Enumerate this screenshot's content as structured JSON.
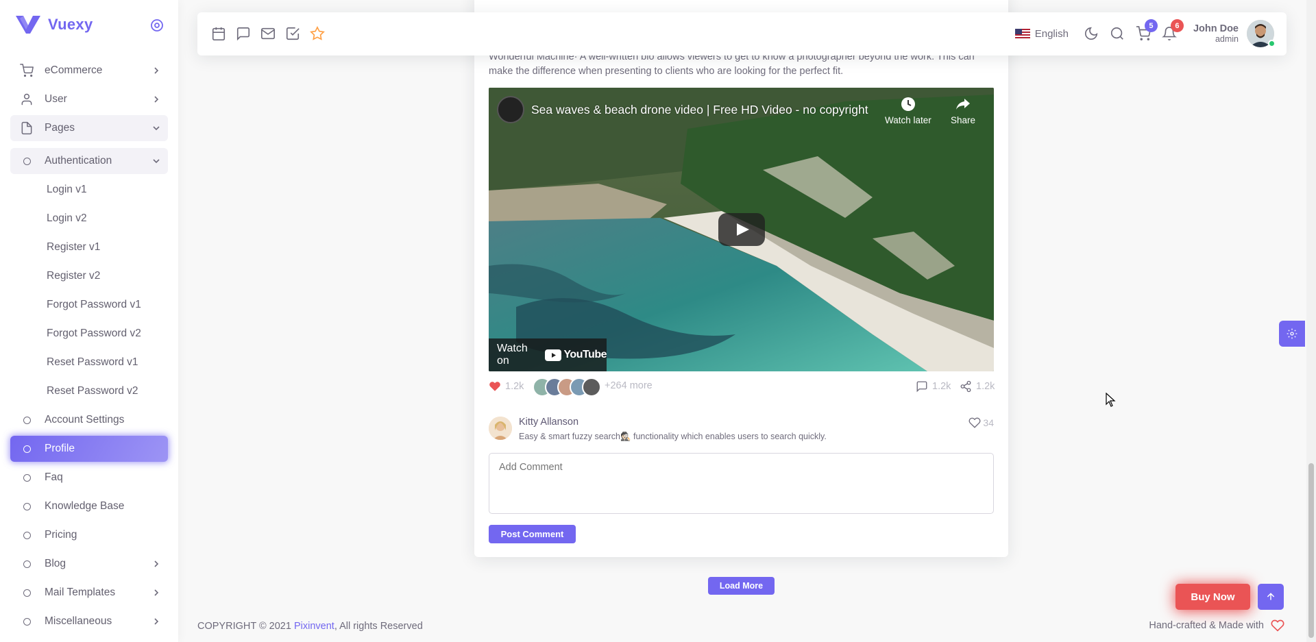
{
  "brand": {
    "name": "Vuexy",
    "color": "#7367f0"
  },
  "sidebar": {
    "items": [
      {
        "label": "eCommerce",
        "icon": "shopping-cart-icon",
        "chevron": "right"
      },
      {
        "label": "User",
        "icon": "user-icon",
        "chevron": "right"
      },
      {
        "label": "Pages",
        "icon": "file-icon",
        "chevron": "down",
        "state": "open"
      },
      {
        "label": "Authentication",
        "icon": "circle-icon",
        "chevron": "down",
        "state": "open"
      },
      {
        "label": "Login v1"
      },
      {
        "label": "Login v2"
      },
      {
        "label": "Register v1"
      },
      {
        "label": "Register v2"
      },
      {
        "label": "Forgot Password v1"
      },
      {
        "label": "Forgot Password v2"
      },
      {
        "label": "Reset Password v1"
      },
      {
        "label": "Reset Password v2"
      },
      {
        "label": "Account Settings",
        "icon": "circle-icon"
      },
      {
        "label": "Profile",
        "icon": "circle-icon",
        "state": "active"
      },
      {
        "label": "Faq",
        "icon": "circle-icon"
      },
      {
        "label": "Knowledge Base",
        "icon": "circle-icon"
      },
      {
        "label": "Pricing",
        "icon": "circle-icon"
      },
      {
        "label": "Blog",
        "icon": "circle-icon",
        "chevron": "right"
      },
      {
        "label": "Mail Templates",
        "icon": "circle-icon",
        "chevron": "right"
      },
      {
        "label": "Miscellaneous",
        "icon": "circle-icon",
        "chevron": "right"
      }
    ]
  },
  "navbar": {
    "bookmarks": [
      "calendar-icon",
      "message-square-icon",
      "mail-icon",
      "check-square-icon",
      "star-icon"
    ],
    "language": "English",
    "cart_count": "5",
    "notification_count": "6",
    "user_name": "John Doe",
    "user_role": "admin"
  },
  "post": {
    "bio": "Wonderful Machine· A well-written bio allows viewers to get to know a photographer beyond the work. This can make the difference when presenting to clients who are looking for the perfect fit.",
    "video": {
      "title": "Sea waves & beach drone video | Free HD Video - no copyright",
      "watch_later": "Watch later",
      "share": "Share",
      "watch_on": "Watch on",
      "youtube": "YouTube"
    },
    "likes": "1.2k",
    "more_likers": "+264 more",
    "comments_count": "1.2k",
    "shares_count": "1.2k",
    "comment": {
      "author": "Kitty Allanson",
      "text": "Easy & smart fuzzy search🕵🏻 functionality which enables users to search quickly.",
      "likes": "34"
    },
    "comment_placeholder": "Add Comment",
    "post_button": "Post Comment"
  },
  "load_more": "Load More",
  "footer": {
    "copyright": "COPYRIGHT © 2021 ",
    "company": "Pixinvent",
    "rights": ", All rights Reserved",
    "made_with": "Hand-crafted & Made with"
  },
  "buy_now": "Buy Now",
  "colors": {
    "primary": "#7367f0",
    "danger": "#ea5455",
    "success": "#28c76f"
  }
}
